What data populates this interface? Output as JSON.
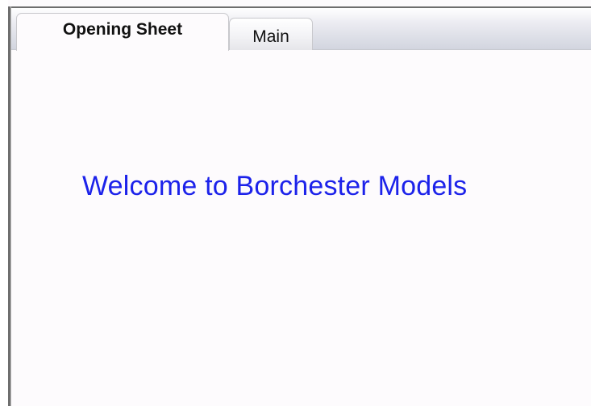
{
  "tabs": [
    {
      "label": "Opening Sheet",
      "active": true
    },
    {
      "label": "Main",
      "active": false
    }
  ],
  "main": {
    "welcome_text": "Welcome to Borchester Models"
  },
  "colors": {
    "welcome_text": "#1c22ea",
    "page_background": "#fdfbfd",
    "tab_strip": "#d2d5df",
    "frame_border": "#6e6e6e"
  }
}
